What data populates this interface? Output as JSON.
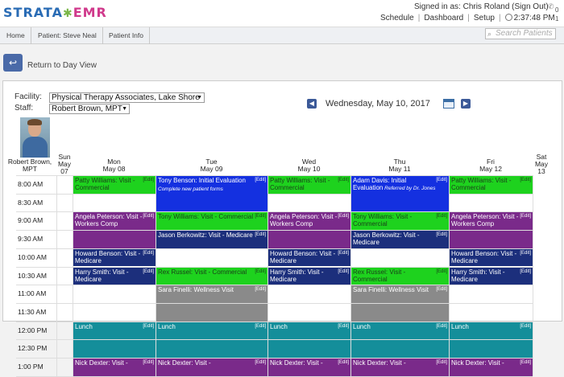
{
  "brand": {
    "part1": "STRATA",
    "part2": "EMR"
  },
  "header": {
    "signed_in": "Signed in as: Chris Roland (Sign Out)",
    "nav": [
      "Schedule",
      "Dashboard",
      "Setup"
    ],
    "time": "2:37:48 PM",
    "count_top": "0",
    "count_bottom": "1"
  },
  "breadcrumb": [
    "Home",
    "Patient: Steve Neal",
    "Patient Info"
  ],
  "search": {
    "placeholder": "Search Patients"
  },
  "back": {
    "label": "Return to Day View"
  },
  "filters": {
    "facility_label": "Facility:",
    "facility_value": "Physical Therapy Associates, Lake Shore",
    "staff_label": "Staff:",
    "staff_value": "Robert Brown, MPT"
  },
  "date_title": "Wednesday, May 10, 2017",
  "staff_display": "Robert Brown, MPT",
  "days": [
    {
      "name": "Sun",
      "date": "May 07"
    },
    {
      "name": "Mon",
      "date": "May 08"
    },
    {
      "name": "Tue",
      "date": "May 09"
    },
    {
      "name": "Wed",
      "date": "May 10"
    },
    {
      "name": "Thu",
      "date": "May 11"
    },
    {
      "name": "Fri",
      "date": "May 12"
    },
    {
      "name": "Sat",
      "date": "May 13"
    }
  ],
  "times": [
    "8:00 AM",
    "8:30 AM",
    "9:00 AM",
    "9:30 AM",
    "10:00 AM",
    "10:30 AM",
    "11:00 AM",
    "11:30 AM",
    "12:00 PM",
    "12:30 PM",
    "1:00 PM"
  ],
  "edit_label": "Edit",
  "appointments": [
    {
      "day": 1,
      "start": 0,
      "span": 1,
      "color": "green",
      "text": "Patty Williams: Visit - Commercial"
    },
    {
      "day": 1,
      "start": 2,
      "span": 1,
      "color": "purple",
      "text": "Angela Peterson: Visit - Workers Comp"
    },
    {
      "day": 1,
      "start": 4,
      "span": 1,
      "color": "navy",
      "text": "Howard Benson: Visit - Medicare"
    },
    {
      "day": 1,
      "start": 5,
      "span": 1,
      "color": "navy",
      "text": "Harry Smith: Visit - Medicare"
    },
    {
      "day": 1,
      "start": 8,
      "span": 1,
      "color": "teal",
      "text": "Lunch"
    },
    {
      "day": 1,
      "start": 10,
      "span": 1,
      "color": "purple",
      "text": "Nick Dexter: Visit -"
    },
    {
      "day": 2,
      "start": 0,
      "span": 2,
      "color": "blue",
      "text": "Tony Benson: Initial Evaluation",
      "sub": "Complete new patient forms"
    },
    {
      "day": 2,
      "start": 2,
      "span": 1,
      "color": "green",
      "text": "Tony Williams: Visit - Commercial"
    },
    {
      "day": 2,
      "start": 3,
      "span": 1,
      "color": "navy",
      "text": "Jason Berkowitz: Visit - Medicare"
    },
    {
      "day": 2,
      "start": 5,
      "span": 1,
      "color": "green",
      "text": "Rex Russel: Visit - Commercial"
    },
    {
      "day": 2,
      "start": 6,
      "span": 1,
      "color": "gray",
      "text": "Sara Finelli: Wellness Visit"
    },
    {
      "day": 2,
      "start": 8,
      "span": 1,
      "color": "teal",
      "text": "Lunch"
    },
    {
      "day": 2,
      "start": 10,
      "span": 1,
      "color": "purple",
      "text": "Nick Dexter: Visit -"
    },
    {
      "day": 3,
      "start": 0,
      "span": 1,
      "color": "green",
      "text": "Patty Williams: Visit - Commercial"
    },
    {
      "day": 3,
      "start": 2,
      "span": 1,
      "color": "purple",
      "text": "Angela Peterson: Visit - Workers Comp"
    },
    {
      "day": 3,
      "start": 4,
      "span": 1,
      "color": "navy",
      "text": "Howard Benson: Visit - Medicare"
    },
    {
      "day": 3,
      "start": 5,
      "span": 1,
      "color": "navy",
      "text": "Harry Smith: Visit - Medicare"
    },
    {
      "day": 3,
      "start": 8,
      "span": 1,
      "color": "teal",
      "text": "Lunch"
    },
    {
      "day": 3,
      "start": 10,
      "span": 1,
      "color": "purple",
      "text": "Nick Dexter: Visit -"
    },
    {
      "day": 4,
      "start": 0,
      "span": 2,
      "color": "blue",
      "text": "Adam Davis: Initial Evaluation",
      "sub": "Referred by Dr. Jones"
    },
    {
      "day": 4,
      "start": 2,
      "span": 1,
      "color": "green",
      "text": "Tony Williams: Visit - Commercial"
    },
    {
      "day": 4,
      "start": 3,
      "span": 1,
      "color": "navy",
      "text": "Jason Berkowitz: Visit - Medicare"
    },
    {
      "day": 4,
      "start": 5,
      "span": 1,
      "color": "green",
      "text": "Rex Russel: Visit - Commercial"
    },
    {
      "day": 4,
      "start": 6,
      "span": 1,
      "color": "gray",
      "text": "Sara Finelli: Wellness Visit"
    },
    {
      "day": 4,
      "start": 8,
      "span": 1,
      "color": "teal",
      "text": "Lunch"
    },
    {
      "day": 4,
      "start": 10,
      "span": 1,
      "color": "purple",
      "text": "Nick Dexter: Visit -"
    },
    {
      "day": 5,
      "start": 0,
      "span": 1,
      "color": "green",
      "text": "Patty Williams: Visit - Commercial"
    },
    {
      "day": 5,
      "start": 2,
      "span": 1,
      "color": "purple",
      "text": "Angela Peterson: Visit - Workers Comp"
    },
    {
      "day": 5,
      "start": 4,
      "span": 1,
      "color": "navy",
      "text": "Howard Benson: Visit - Medicare"
    },
    {
      "day": 5,
      "start": 5,
      "span": 1,
      "color": "navy",
      "text": "Harry Smith: Visit - Medicare"
    },
    {
      "day": 5,
      "start": 8,
      "span": 1,
      "color": "teal",
      "text": "Lunch"
    },
    {
      "day": 5,
      "start": 10,
      "span": 1,
      "color": "purple",
      "text": "Nick Dexter: Visit -"
    }
  ],
  "fillers": [
    {
      "day": 1,
      "start": 3,
      "span": 1,
      "color": "purple"
    },
    {
      "day": 3,
      "start": 3,
      "span": 1,
      "color": "purple"
    },
    {
      "day": 5,
      "start": 3,
      "span": 1,
      "color": "purple"
    },
    {
      "day": 1,
      "start": 9,
      "span": 1,
      "color": "teal"
    },
    {
      "day": 2,
      "start": 9,
      "span": 1,
      "color": "teal"
    },
    {
      "day": 3,
      "start": 9,
      "span": 1,
      "color": "teal"
    },
    {
      "day": 4,
      "start": 9,
      "span": 1,
      "color": "teal"
    },
    {
      "day": 5,
      "start": 9,
      "span": 1,
      "color": "teal"
    },
    {
      "day": 2,
      "start": 7,
      "span": 1,
      "color": "gray"
    },
    {
      "day": 4,
      "start": 7,
      "span": 1,
      "color": "gray"
    }
  ],
  "icons": {
    "back": "return-arrow-icon",
    "prev": "prev-arrow-icon",
    "next": "next-arrow-icon",
    "calendar": "calendar-icon",
    "search": "search-icon",
    "clock": "clock-icon",
    "phone": "phone-icon"
  }
}
